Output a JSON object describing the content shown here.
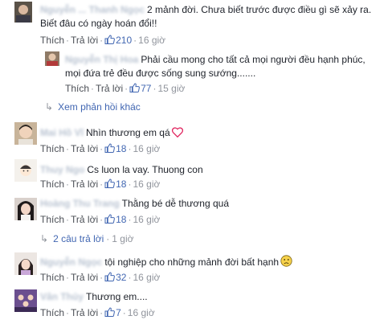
{
  "ui": {
    "like_label": "Thích",
    "reply_label": "Trả lời",
    "dot": "·"
  },
  "comments": [
    {
      "name": "Nguyễn ... Thanh Ngọc",
      "text_line1": "2 mảnh đời. Chưa biết trước được điều gì sẽ xảy ra.",
      "text_line2": "Biết đâu có ngày hoán đổi!!",
      "likes": "210",
      "time": "16 giờ"
    },
    {
      "name": "Nguyễn Thị Hoa",
      "text_line1": "Phải cầu mong cho tất cả mọi người đều hạnh phúc,",
      "text_line2": "mọi đứa trẻ đều được sống sung sướng.......",
      "likes": "77",
      "time": "15 giờ"
    },
    {
      "more_replies": "Xem phản hồi khác"
    },
    {
      "name": "Mai Hồ Vĩ",
      "text": "Nhìn thương em qá",
      "likes": "18",
      "time": "16 giờ"
    },
    {
      "name": "Thuy Ngo",
      "text": "Cs luon la vay. Thuong con",
      "likes": "18",
      "time": "16 giờ"
    },
    {
      "name": "Hoàng Thu Trang",
      "text": "Thằng bé dễ thương quá",
      "likes": "18",
      "time": "16 giờ"
    },
    {
      "replies": "2 câu trả lời",
      "time": "1 giờ"
    },
    {
      "name": "Nguyễn Ngọc",
      "text": "tội nghiệp cho những mảnh đời bất hạnh",
      "likes": "32",
      "time": "16 giờ"
    },
    {
      "name": "Vân Thủy",
      "text": "Thương em....",
      "likes": "7",
      "time": "16 giờ"
    }
  ],
  "colors": {
    "link": "#4267b2",
    "meta": "#90949c",
    "text": "#1d2129"
  }
}
